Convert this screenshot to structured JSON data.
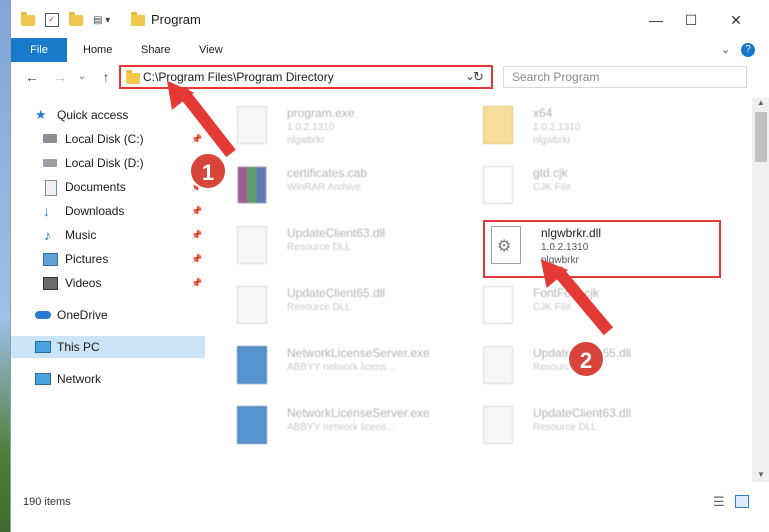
{
  "window": {
    "title": "Program",
    "minimize_glyph": "—",
    "maximize_glyph": "☐",
    "close_glyph": "✕"
  },
  "ribbon": {
    "tabs": [
      "File",
      "Home",
      "Share",
      "View"
    ],
    "help_glyph": "?",
    "expand_glyph": "⌄"
  },
  "nav": {
    "back_glyph": "←",
    "forward_glyph": "→",
    "recent_glyph": "⌄",
    "up_glyph": "↑",
    "address": "C:\\Program Files\\Program Directory",
    "refresh_glyph": "↻",
    "search_placeholder": "Search Program"
  },
  "sidebar": {
    "items": [
      {
        "label": "Quick access",
        "icon": "star-icon",
        "pinned": false
      },
      {
        "label": "Local Disk (C:)",
        "icon": "drive-icon",
        "pinned": true
      },
      {
        "label": "Local Disk (D:)",
        "icon": "drive-icon",
        "pinned": true
      },
      {
        "label": "Documents",
        "icon": "documents-icon",
        "pinned": true
      },
      {
        "label": "Downloads",
        "icon": "download-icon",
        "pinned": true
      },
      {
        "label": "Music",
        "icon": "music-icon",
        "pinned": true
      },
      {
        "label": "Pictures",
        "icon": "pictures-icon",
        "pinned": true
      },
      {
        "label": "Videos",
        "icon": "videos-icon",
        "pinned": true
      },
      {
        "label": "OneDrive",
        "icon": "cloud-icon",
        "pinned": false
      },
      {
        "label": "This PC",
        "icon": "computer-icon",
        "pinned": false,
        "selected": true
      },
      {
        "label": "Network",
        "icon": "network-icon",
        "pinned": false
      }
    ]
  },
  "files": [
    {
      "name": "program.exe",
      "line1": "1.0.2.1310",
      "line2": "nlgwbrkr"
    },
    {
      "name": "x64",
      "line1": "1.0.2.1310",
      "line2": "nlgwbrkr"
    },
    {
      "name": "certificates.cab",
      "line1": "WinRAR Archive",
      "line2": ""
    },
    {
      "name": "gtd.cjk",
      "line1": "CJK File",
      "line2": ""
    },
    {
      "name": "UpdateClient63.dll",
      "line1": "Resource DLL",
      "line2": ""
    },
    {
      "name": "nlgwbrkr.dll",
      "line1": "1.0.2.1310",
      "line2": "nlgwbrkr"
    },
    {
      "name": "UpdateClient65.dll",
      "line1": "Resource DLL",
      "line2": ""
    },
    {
      "name": "FontFont.cjk",
      "line1": "CJK File",
      "line2": ""
    },
    {
      "name": "NetworkLicenseServer.exe",
      "line1": "ABBYY network licens...",
      "line2": ""
    },
    {
      "name": "UpdateClient65.dll",
      "line1": "Resource DLL",
      "line2": ""
    },
    {
      "name": "NetworkLicenseServer.exe",
      "line1": "ABBYY network licens...",
      "line2": ""
    },
    {
      "name": "UpdateClient63.dll",
      "line1": "Resource DLL",
      "line2": ""
    }
  ],
  "status": {
    "count": "190 items"
  },
  "annotations": {
    "step1": "1",
    "step2": "2"
  },
  "colors": {
    "accent": "#1979ca",
    "highlight": "#e53935",
    "selected": "#cce4f7"
  }
}
